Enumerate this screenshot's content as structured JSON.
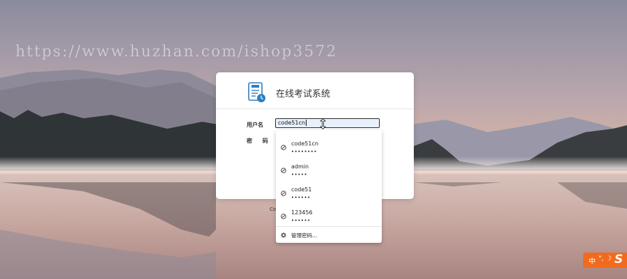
{
  "watermark": "https://www.huzhan.com/ishop3572",
  "login": {
    "title": "在线考试系统",
    "username_label": "用户名",
    "password_label": "密 码",
    "username_value": "code51cn",
    "copyright": "Co"
  },
  "autofill": {
    "items": [
      {
        "username": "code51cn",
        "password_mask": "••••••••"
      },
      {
        "username": "admin",
        "password_mask": "•••••"
      },
      {
        "username": "code51",
        "password_mask": "••••••"
      },
      {
        "username": "123456",
        "password_mask": "••••••"
      }
    ],
    "manage_label": "管理密码..."
  },
  "ime": {
    "mode": "中",
    "punct": "°,",
    "moon": "☽",
    "logo": "S"
  },
  "colors": {
    "accent": "#f26b1d",
    "input_bg": "#e8f0fe"
  },
  "icons": {
    "item": "key-globe-icon",
    "manage": "gear-icon"
  }
}
